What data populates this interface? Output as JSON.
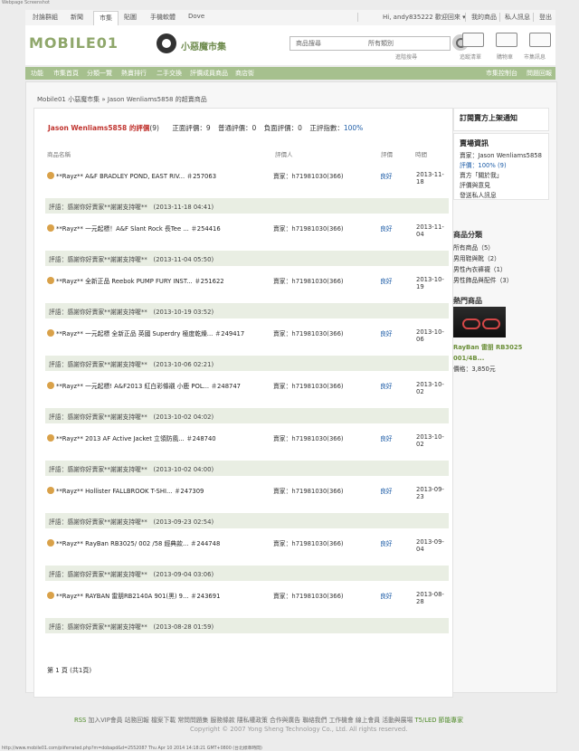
{
  "browser": {
    "top_left_text": "Webpage Screenshot",
    "status_url": "http://www.mobile01.com/piiferrated.php?m=dobapd&d=2552087 Thu Apr 10 2014 14:18:21 GMT+0800 (台北標準時間)"
  },
  "topbar": {
    "tabs": [
      "討論群組",
      "新聞",
      "市集",
      "貼圖",
      "手機軟體",
      "Dove"
    ],
    "active_tab_index": 2,
    "user_text": "Hi, andy835222 歡迎回來 ▾",
    "right_links": [
      "我的商品",
      "私人訊息",
      "登出"
    ]
  },
  "header": {
    "logo_text": "MOBILE01",
    "logo_subtitle": "小惡魔市集",
    "search_placeholder": "商品搜尋",
    "search_category": "所有類別",
    "advanced_search": "進階搜尋",
    "tools": [
      "追蹤清單",
      "購物車",
      "市集訊息"
    ]
  },
  "nav": {
    "items": [
      "功能",
      "市集首頁",
      "分類一覽",
      "熱賣排行",
      "二手交換",
      "評價成員商品",
      "商店街"
    ],
    "right_items": [
      "市集控制台",
      "問題回報"
    ]
  },
  "breadcrumb": "Mobile01 小惡魔市集 » Jason Wenliams5858 的超賣商品",
  "ratings": {
    "user_label": "Jason Wenliams5858 的評價",
    "total_count": "(9)",
    "positive_text": "正面評價：9",
    "neutral_text": "普通評價：0",
    "negative_text": "負面評價：0",
    "index_label": "正評指數：",
    "index_value": "100%",
    "columns": [
      "商品名稱",
      "評價人",
      "評價",
      "時間"
    ],
    "rows": [
      {
        "title": "**Rayz** A&F BRADLEY POND, EAST RIV... ＃257063",
        "seller": "賣家：h71981030(366)",
        "rate": "良好",
        "date": "2013-11-18",
        "comment": "評語：感謝你好賣家**謝謝支持喔**　(2013-11-18 04:41)"
      },
      {
        "title": "**Rayz** 一元起標！A&F Slant Rock 長Tee ...  ＃254416",
        "seller": "賣家：h71981030(366)",
        "rate": "良好",
        "date": "2013-11-04",
        "comment": "評語：感謝你好賣家**謝謝支持喔**　(2013-11-04 05:50)"
      },
      {
        "title": "**Rayz** 全新正品 Reebok PUMP FURY INST...  ＃251622",
        "seller": "賣家：h71981030(366)",
        "rate": "良好",
        "date": "2013-10-19",
        "comment": "評語：感謝你好賣家**謝謝支持喔**　(2013-10-19 03:52)"
      },
      {
        "title": "**Rayz** 一元起標 全新正品 英國 Superdry 極度乾燥...  ＃249417",
        "seller": "賣家：h71981030(366)",
        "rate": "良好",
        "date": "2013-10-06",
        "comment": "評語：感謝你好賣家**謝謝支持喔**　(2013-10-06 02:21)"
      },
      {
        "title": "**Rayz** 一元起標! A&F2013 紅白彩條襯 小鹿 POL...  ＃248747",
        "seller": "賣家：h71981030(366)",
        "rate": "良好",
        "date": "2013-10-02",
        "comment": "評語：感謝你好賣家**謝謝支持喔**　(2013-10-02 04:02)"
      },
      {
        "title": "**Rayz** 2013 AF Active Jacket 立領防風...  ＃248740",
        "seller": "賣家：h71981030(366)",
        "rate": "良好",
        "date": "2013-10-02",
        "comment": "評語：感謝你好賣家**謝謝支持喔**　(2013-10-02 04:00)"
      },
      {
        "title": "**Rayz** Hollister FALLBROOK T-SHI...  ＃247309",
        "seller": "賣家：h71981030(366)",
        "rate": "良好",
        "date": "2013-09-23",
        "comment": "評語：感謝你好賣家**謝謝支持喔**　(2013-09-23 02:54)"
      },
      {
        "title": "**Rayz** RayBan RB3025/ 002 /58 經典款...  ＃244748",
        "seller": "賣家：h71981030(366)",
        "rate": "良好",
        "date": "2013-09-04",
        "comment": "評語：感謝你好賣家**謝謝支持喔**　(2013-09-04 03:06)"
      },
      {
        "title": "**Rayz** RAYBAN 雷朋RB2140A 901(黑) 9...  ＃243691",
        "seller": "賣家：h71981030(366)",
        "rate": "良好",
        "date": "2013-08-28",
        "comment": "評語：感謝你好賣家**謝謝支持喔**　(2013-08-28 01:59)"
      }
    ],
    "pager": "第 1 頁 (共1頁)"
  },
  "sidebar": {
    "subscribe_title": "訂閱賣方上架通知",
    "seller_info_title": "賣場資訊",
    "seller_name": "賣家：Jason Wenliams5858",
    "seller_rate": "評價：100% (9)",
    "seller_links": [
      "賣方「關於我」",
      "評價與意見",
      "發送私人訊息"
    ],
    "category_title": "商品分類",
    "categories": [
      "所有商品（5）",
      "男用鞋與靴（2）",
      "男性內衣褲襪（1）",
      "男性飾品與配件（3）"
    ],
    "hot_title": "熱門商品",
    "hot_name": "RayBan 雷朋 RB3025 001/4B...",
    "hot_price": "價格：3,850元"
  },
  "footer": {
    "links": [
      "RSS",
      "加入VIP會員",
      "站務回報",
      "檔案下載",
      "常問問題集",
      "服務條款",
      "隱私權政策",
      "合作與廣告",
      "聯絡我們",
      "工作機會",
      "線上會員",
      "活動與展場",
      "T5/LED 節能專家"
    ],
    "copyright": "Copyright © 2007 Yong Sheng Technology Co., Ltd. All rights reserved."
  }
}
